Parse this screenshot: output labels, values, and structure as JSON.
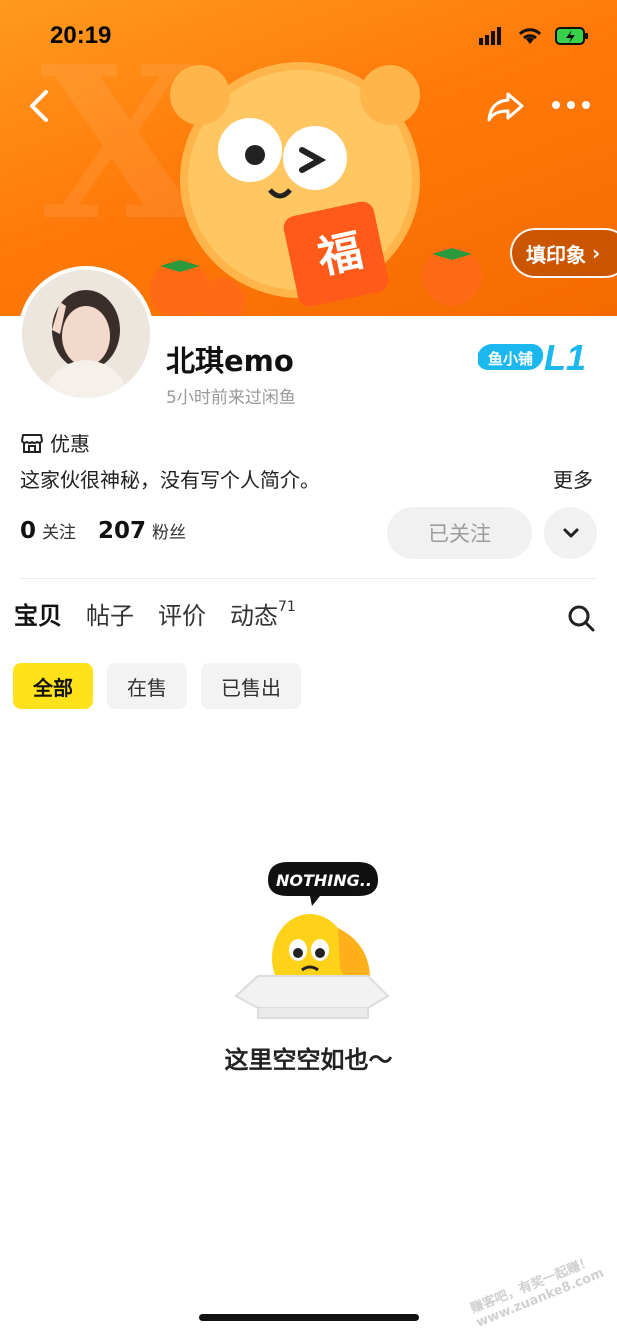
{
  "status_bar": {
    "time": "20:19"
  },
  "banner": {
    "stamp_button": "填印象",
    "stamp_chevron": "›"
  },
  "profile": {
    "username": "北琪emo",
    "last_seen": "5小时前来过闲鱼",
    "level_badge_label": "鱼小铺",
    "level": "L1",
    "promo_label": "优惠",
    "bio": "这家伙很神秘，没有写个人简介。",
    "more_label": "更多",
    "following_count": "0",
    "following_label": "关注",
    "followers_count": "207",
    "followers_label": "粉丝",
    "follow_button": "已关注"
  },
  "tabs": [
    {
      "label": "宝贝",
      "badge": ""
    },
    {
      "label": "帖子",
      "badge": ""
    },
    {
      "label": "评价",
      "badge": ""
    },
    {
      "label": "动态",
      "badge": "71"
    }
  ],
  "filters": [
    {
      "label": "全部"
    },
    {
      "label": "在售"
    },
    {
      "label": "已售出"
    }
  ],
  "empty_state": {
    "bubble": "NOTHING..",
    "message": "这里空空如也～"
  },
  "watermark": "赚客吧，有奖一起赚！ www.zuanke8.com",
  "colors": {
    "accent_yellow": "#ffe21a",
    "banner_orange": "#ff7a0a",
    "level_blue": "#1bb8f0"
  }
}
